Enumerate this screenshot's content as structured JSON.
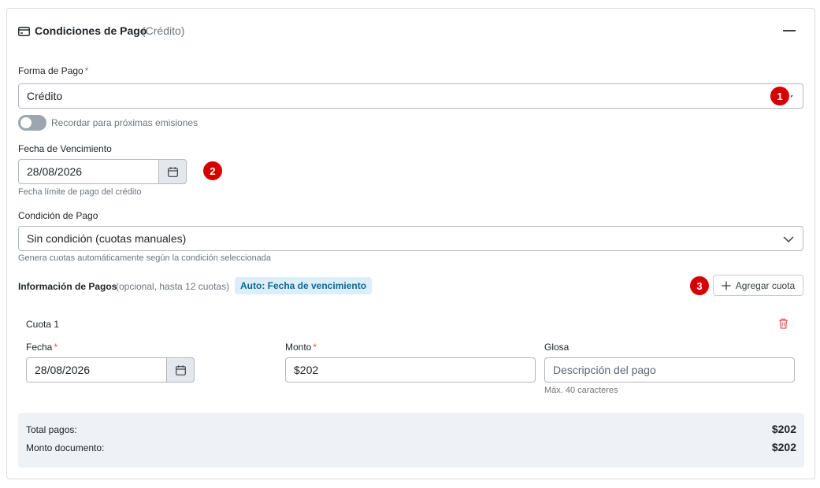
{
  "header": {
    "title": "Condiciones de Pago",
    "subtitle": "(Crédito)"
  },
  "forma_pago": {
    "label": "Forma de Pago",
    "required": "*",
    "value": "Crédito",
    "marker": "1"
  },
  "remember": {
    "label": "Recordar para próximas emisiones",
    "enabled": false
  },
  "vencimiento": {
    "label": "Fecha de Vencimiento",
    "value": "28/08/2026",
    "help": "Fecha límite de pago del crédito",
    "marker": "2"
  },
  "condicion": {
    "label": "Condición de Pago",
    "value": "Sin condición (cuotas manuales)",
    "help": "Genera cuotas automáticamente según la condición seleccionada"
  },
  "pagos": {
    "title": "Información de Pagos",
    "subtitle": "(opcional, hasta 12 cuotas)",
    "auto_badge": "Auto: Fecha de vencimiento",
    "add_label": "Agregar cuota",
    "marker": "3"
  },
  "cuota": {
    "title": "Cuota 1",
    "fecha_label": "Fecha",
    "fecha_required": "*",
    "fecha_value": "28/08/2026",
    "monto_label": "Monto",
    "monto_required": "*",
    "monto_value": "$202",
    "glosa_label": "Glosa",
    "glosa_placeholder": "Descripción del pago",
    "glosa_help": "Máx. 40 caracteres"
  },
  "totals": {
    "pagos_label": "Total pagos:",
    "pagos_value": "$202",
    "documento_label": "Monto documento:",
    "documento_value": "$202"
  },
  "colors": {
    "marker": "#d60000",
    "badge_bg": "#dbeefa",
    "badge_text": "#0b6996",
    "delete": "#e55353"
  }
}
